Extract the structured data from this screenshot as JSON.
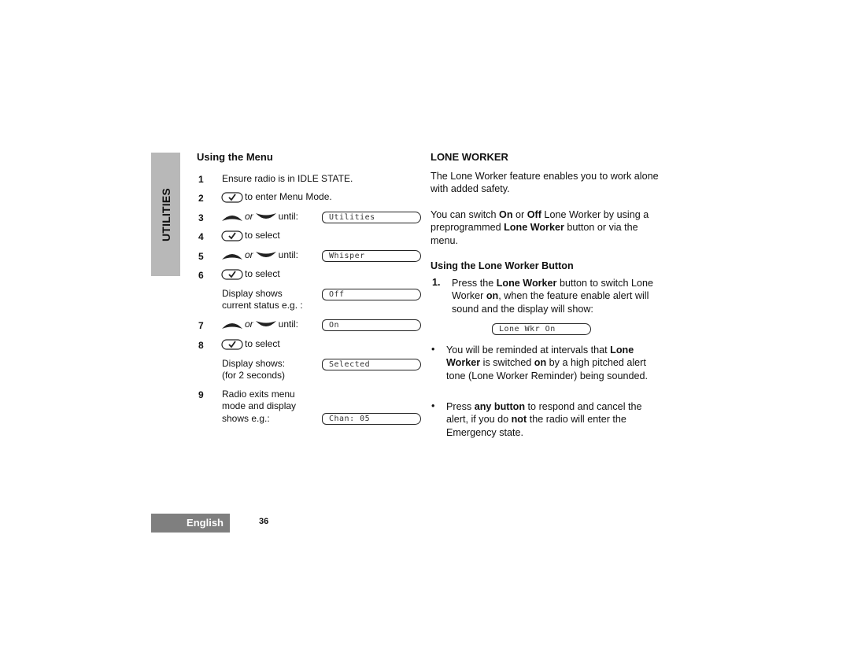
{
  "side_tab": {
    "label": "UTILITIES"
  },
  "menu_section": {
    "title": "Using the Menu",
    "steps": [
      {
        "num": "1",
        "text": "Ensure radio is in IDLE STATE."
      },
      {
        "num": "2",
        "key": "check-key",
        "text": "to enter Menu Mode."
      },
      {
        "num": "3",
        "key": "up-down-keys",
        "or": "or",
        "text": "until:",
        "display": "Utilities"
      },
      {
        "num": "4",
        "key": "check-key",
        "text": "to select"
      },
      {
        "num": "5",
        "key": "up-down-keys",
        "or": "or",
        "text": "until:",
        "display": "Whisper"
      },
      {
        "num": "6",
        "key": "check-key",
        "text": "to select"
      },
      {
        "num": "",
        "text_lines": [
          "Display shows",
          "current status e.g. :"
        ],
        "display": "Off"
      },
      {
        "num": "7",
        "key": "up-down-keys",
        "or": "or",
        "text": "until:",
        "display": "On"
      },
      {
        "num": "8",
        "key": "check-key",
        "text": "to select"
      },
      {
        "num": "",
        "text_lines": [
          "Display shows:",
          "(for 2 seconds)"
        ],
        "display": "Selected"
      },
      {
        "num": "9",
        "text_lines": [
          "Radio exits menu",
          "mode and display",
          "shows e.g.:"
        ],
        "display": "Chan: 05"
      }
    ]
  },
  "lone_worker": {
    "title": "LONE WORKER",
    "intro": "The Lone Worker feature enables you to work alone with added safety.",
    "para2": {
      "a": "You can switch ",
      "on": "On",
      "b": " or ",
      "off": "Off",
      "c": " Lone Worker by using a preprogrammed ",
      "lw": "Lone Worker",
      "d": " button or via the menu."
    },
    "button_section_title": "Using the Lone Worker Button",
    "step1": {
      "num": "1.",
      "a": "Press the ",
      "lw": "Lone Worker",
      "b": " button to switch Lone Worker ",
      "on": "on",
      "c": ", when the feature enable alert  will sound and the display will show:",
      "display": "Lone Wkr On"
    },
    "bullet1": {
      "a": "You will be reminded at intervals that ",
      "lw": "Lone Worker",
      "b": " is switched ",
      "on": "on",
      "c": " by a high pitched alert tone (Lone Worker Reminder) being sounded."
    },
    "bullet2": {
      "a": "Press ",
      "any": "any button",
      "b": " to respond and cancel the alert, if you do ",
      "not": "not",
      "c": " the radio will enter the Emergency state."
    },
    "bullet_char": "•"
  },
  "footer": {
    "language": "English",
    "page_number": "36"
  }
}
